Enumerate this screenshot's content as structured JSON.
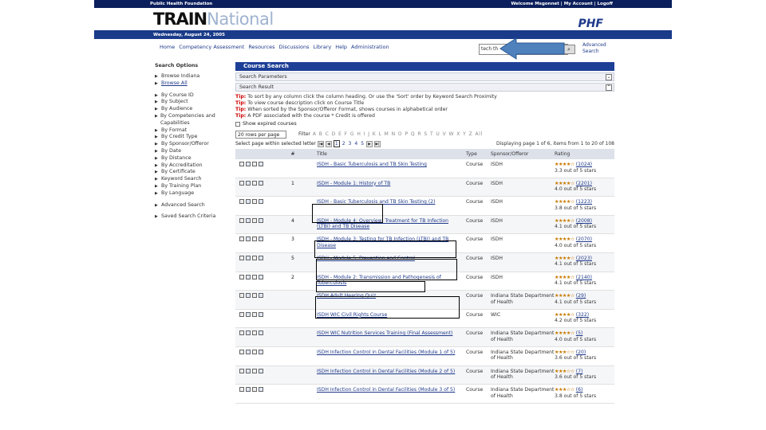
{
  "topbar": {
    "left": "Public Health Foundation",
    "right": "Welcome Msgonnet | My Account | Logoff"
  },
  "logo": {
    "train": "TRAIN",
    "national": "National",
    "phf": "PHF"
  },
  "date": "Wednesday, August 24, 2005",
  "nav": [
    "Home",
    "Competency Assessment",
    "Resources",
    "Discussions",
    "Library",
    "Help",
    "Administration"
  ],
  "search": {
    "value": "tech th",
    "button": "Go",
    "advanced": "Advanced Search"
  },
  "sidebar": {
    "title": "Search Options",
    "items": [
      "Browse Indiana",
      "Browse All",
      "By Course ID",
      "By Subject",
      "By Audience",
      "By Competencies and Capabilities",
      "By Format",
      "By Credit Type",
      "By Sponsor/Offeror",
      "By Date",
      "By Distance",
      "By Accreditation",
      "By Certificate",
      "Keyword Search",
      "By Training Plan",
      "By Language",
      "Advanced Search",
      "Saved Search Criteria"
    ]
  },
  "main": {
    "heading": "Course Search",
    "panels": [
      "Search Parameters",
      "Search Result"
    ],
    "tips": [
      "To sort by any column click the column heading. Or use the 'Sort' order by Keyword Search Proximity",
      "To view course description click on Course Title",
      "When sorted by the Sponsor/Offeror Format, shows courses in alphabetical order",
      "A PDF associated with the course  * Credit is offered"
    ],
    "tip_label": "Tip:",
    "show_expired": "Show expired courses",
    "rows_per_page": "20 rows per page",
    "filter_label": "Filter",
    "letters": [
      "A",
      "B",
      "C",
      "D",
      "E",
      "F",
      "G",
      "H",
      "I",
      "J",
      "K",
      "L",
      "M",
      "N",
      "O",
      "P",
      "Q",
      "R",
      "S",
      "T",
      "U",
      "V",
      "W",
      "X",
      "Y",
      "Z",
      "All"
    ],
    "page_label": "Select page within selected letter",
    "pages": [
      "1",
      "2",
      "3",
      "4",
      "5"
    ],
    "displaying": "Displaying page 1 of 6, items from 1 to 20 of 108",
    "columns": {
      "num": "#",
      "title": "Title",
      "type": "Type",
      "sponsor": "Sponsor/Offeror",
      "rating": "Rating"
    },
    "rows": [
      {
        "num": "",
        "title": "ISDH - Basic Tuberculosis and TB Skin Testing",
        "type": "Course",
        "sponsor": "ISDH",
        "stars": "★★★★☆",
        "count": "(1024)",
        "sub": "3.3 out of 5 stars"
      },
      {
        "num": "1",
        "title": "ISDH - Module 1: History of TB",
        "type": "Course",
        "sponsor": "ISDH",
        "stars": "★★★★☆",
        "count": "(2201)",
        "sub": "4.0 out of 5 stars"
      },
      {
        "num": "",
        "title": "ISDH - Basic Tuberculosis and TB Skin Testing (2)",
        "type": "Course",
        "sponsor": "ISDH",
        "stars": "★★★★☆",
        "count": "(1223)",
        "sub": "3.8 out of 5 stars"
      },
      {
        "num": "4",
        "title": "ISDH - Module 4: Overview: Treatment for TB Infection (LTBI) and TB Disease",
        "type": "Course",
        "sponsor": "ISDH",
        "stars": "★★★★☆",
        "count": "(2008)",
        "sub": "4.1 out of 5 stars"
      },
      {
        "num": "3",
        "title": "ISDH - Module 3: Testing for TB Infection (LTBI) and TB Disease",
        "type": "Course",
        "sponsor": "ISDH",
        "stars": "★★★★☆",
        "count": "(2070)",
        "sub": "4.0 out of 5 stars"
      },
      {
        "num": "5",
        "title": "ISDH - Module 5: Prevention and Control",
        "type": "Course",
        "sponsor": "ISDH",
        "stars": "★★★★☆",
        "count": "(2023)",
        "sub": "4.1 out of 5 stars"
      },
      {
        "num": "2",
        "title": "ISDH - Module 2: Transmission and Pathogenesis of Tuberculosis",
        "type": "Course",
        "sponsor": "ISDH",
        "stars": "★★★★☆",
        "count": "(2140)",
        "sub": "4.1 out of 5 stars"
      },
      {
        "num": "",
        "title": "ISDH Adult Hearing Quiz",
        "type": "Course",
        "sponsor": "Indiana State Department of Health",
        "stars": "★★★★☆",
        "count": "(29)",
        "sub": "4.1 out of 5 stars"
      },
      {
        "num": "",
        "title": "ISDH WIC Civil Rights Course",
        "type": "Course",
        "sponsor": "WIC",
        "stars": "★★★★☆",
        "count": "(322)",
        "sub": "4.2 out of 5 stars"
      },
      {
        "num": "",
        "title": "ISDH WIC Nutrition Services Training (Final Assessment)",
        "type": "Course",
        "sponsor": "Indiana State Department of Health",
        "stars": "★★★★☆",
        "count": "(5)",
        "sub": "4.0 out of 5 stars"
      },
      {
        "num": "",
        "title": "ISDH Infection Control in Dental Facilities (Module 1 of 5)",
        "type": "Course",
        "sponsor": "Indiana State Department of Health",
        "stars": "★★★☆☆",
        "count": "(20)",
        "sub": "3.6 out of 5 stars"
      },
      {
        "num": "",
        "title": "ISDH Infection Control in Dental Facilities (Module 2 of 5)",
        "type": "Course",
        "sponsor": "Indiana State Department of Health",
        "stars": "★★★☆☆",
        "count": "(7)",
        "sub": "3.6 out of 5 stars"
      },
      {
        "num": "",
        "title": "ISDH Infection Control in Dental Facilities (Module 3 of 5)",
        "type": "Course",
        "sponsor": "Indiana State Department of Health",
        "stars": "★★★☆☆",
        "count": "(6)",
        "sub": "3.8 out of 5 stars"
      }
    ]
  }
}
